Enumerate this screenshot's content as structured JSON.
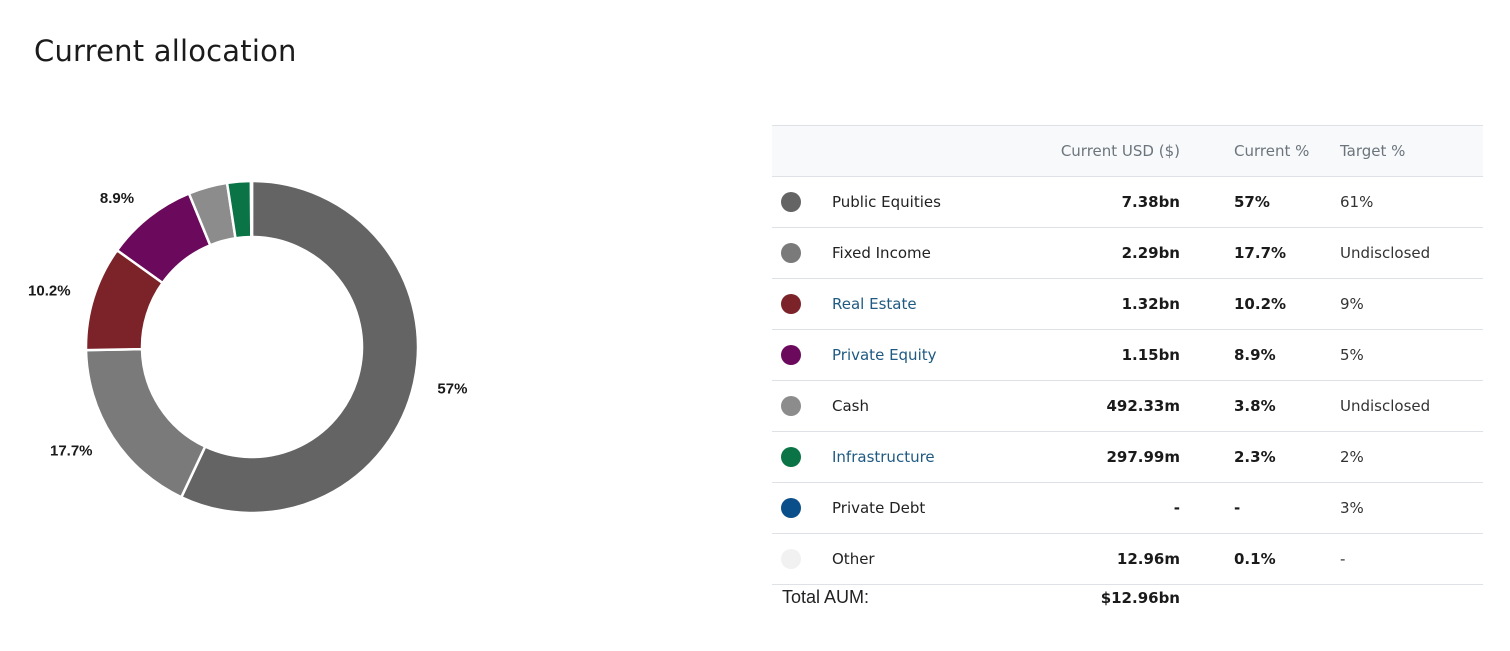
{
  "page": {
    "title": "Current allocation"
  },
  "table": {
    "headers": {
      "usd": "Current USD ($)",
      "current": "Current %",
      "target": "Target %"
    },
    "rows": [
      {
        "name": "Public Equities",
        "usd": "7.38bn",
        "current": "57%",
        "target": "61%",
        "color": "#646464",
        "link": false
      },
      {
        "name": "Fixed Income",
        "usd": "2.29bn",
        "current": "17.7%",
        "target": "Undisclosed",
        "color": "#7a7a7a",
        "link": false
      },
      {
        "name": "Real Estate",
        "usd": "1.32bn",
        "current": "10.2%",
        "target": "9%",
        "color": "#7b2328",
        "link": true
      },
      {
        "name": "Private Equity",
        "usd": "1.15bn",
        "current": "8.9%",
        "target": "5%",
        "color": "#6b0a5c",
        "link": true
      },
      {
        "name": "Cash",
        "usd": "492.33m",
        "current": "3.8%",
        "target": "Undisclosed",
        "color": "#8c8c8c",
        "link": false
      },
      {
        "name": "Infrastructure",
        "usd": "297.99m",
        "current": "2.3%",
        "target": "2%",
        "color": "#0a7447",
        "link": true
      },
      {
        "name": "Private Debt",
        "usd": "-",
        "current": "-",
        "target": "3%",
        "color": "#0b4f8a",
        "link": false
      },
      {
        "name": "Other",
        "usd": "12.96m",
        "current": "0.1%",
        "target": "-",
        "color": "#f1f1f1",
        "link": false
      }
    ],
    "total_label": "Total AUM:",
    "total_value": "$12.96bn"
  },
  "chart_data": {
    "type": "pie",
    "donut": true,
    "slices": [
      {
        "name": "Public Equities",
        "value": 57,
        "label": "57%",
        "color": "#646464"
      },
      {
        "name": "Fixed Income",
        "value": 17.7,
        "label": "17.7%",
        "color": "#7a7a7a"
      },
      {
        "name": "Real Estate",
        "value": 10.2,
        "label": "10.2%",
        "color": "#7b2328"
      },
      {
        "name": "Private Equity",
        "value": 8.9,
        "label": "8.9%",
        "color": "#6b0a5c"
      },
      {
        "name": "Cash",
        "value": 3.8,
        "label": "",
        "color": "#8c8c8c"
      },
      {
        "name": "Infrastructure",
        "value": 2.3,
        "label": "",
        "color": "#0a7447"
      },
      {
        "name": "Private Debt",
        "value": 0,
        "label": "",
        "color": "#0b4f8a"
      },
      {
        "name": "Other",
        "value": 0.1,
        "label": "",
        "color": "#f1f1f1"
      }
    ]
  }
}
